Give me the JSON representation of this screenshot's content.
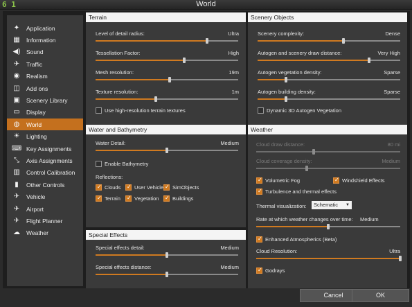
{
  "window": {
    "title": "World",
    "logo": "6 1"
  },
  "sidebar": {
    "items": [
      {
        "label": "Application",
        "icon": "rocket"
      },
      {
        "label": "Information",
        "icon": "▦"
      },
      {
        "label": "Sound",
        "icon": "◀)"
      },
      {
        "label": "Traffic",
        "icon": "✈"
      },
      {
        "label": "Realism",
        "icon": "◉"
      },
      {
        "label": "Add ons",
        "icon": "◫"
      },
      {
        "label": "Scenery Library",
        "icon": "▣"
      },
      {
        "label": "Display",
        "icon": "▭"
      },
      {
        "label": "World",
        "icon": "◍",
        "active": true
      },
      {
        "label": "Lighting",
        "icon": "☀"
      },
      {
        "label": "Key Assignments",
        "icon": "⌨"
      },
      {
        "label": "Axis Assignments",
        "icon": "⤡"
      },
      {
        "label": "Control Calibration",
        "icon": "▥"
      },
      {
        "label": "Other Controls",
        "icon": "▮"
      },
      {
        "label": "Vehicle",
        "icon": "✈"
      },
      {
        "label": "Airport",
        "icon": "✈"
      },
      {
        "label": "Flight Planner",
        "icon": "✈"
      },
      {
        "label": "Weather",
        "icon": "☁"
      }
    ]
  },
  "terrain": {
    "header": "Terrain",
    "rows": [
      {
        "label": "Level of detail radius:",
        "value": "Ultra",
        "level": 0.78
      },
      {
        "label": "Tessellation Factor:",
        "value": "High",
        "level": 0.62
      },
      {
        "label": "Mesh resolution:",
        "value": "19m",
        "level": 0.52
      },
      {
        "label": "Texture resolution:",
        "value": "1m",
        "level": 0.42
      }
    ],
    "checkbox": {
      "label": "Use high-resolution terrain textures",
      "checked": false
    }
  },
  "scenery": {
    "header": "Scenery Objects",
    "rows": [
      {
        "label": "Scenery complexity:",
        "value": "Dense",
        "level": 0.6
      },
      {
        "label": "Autogen and scenery draw distance:",
        "value": "Very High",
        "level": 0.78
      },
      {
        "label": "Autogen vegetation density:",
        "value": "Sparse",
        "level": 0.2
      },
      {
        "label": "Autogen building density:",
        "value": "Sparse",
        "level": 0.2
      }
    ],
    "checkbox": {
      "label": "Dynamic 3D Autogen Vegetation",
      "checked": false
    }
  },
  "water": {
    "header": "Water and Bathymetry",
    "detail": {
      "label": "Water Detail:",
      "value": "Medium",
      "level": 0.5
    },
    "bathymetry": {
      "label": "Enable Bathymetry",
      "checked": false
    },
    "reflections_label": "Reflections:",
    "reflections": [
      {
        "label": "Clouds",
        "checked": true
      },
      {
        "label": "User Vehicle",
        "checked": true
      },
      {
        "label": "SimObjects",
        "checked": true
      },
      {
        "label": "Terrain",
        "checked": true
      },
      {
        "label": "Vegetation",
        "checked": true
      },
      {
        "label": "Buildings",
        "checked": true
      }
    ]
  },
  "effects": {
    "header": "Special Effects",
    "rows": [
      {
        "label": "Special effects detail:",
        "value": "Medium",
        "level": 0.5
      },
      {
        "label": "Special effects distance:",
        "value": "Medium",
        "level": 0.5
      }
    ]
  },
  "weather": {
    "header": "Weather",
    "cloud_draw": {
      "label": "Cloud draw distance:",
      "value": "80 mi",
      "level": 0.4
    },
    "cloud_coverage": {
      "label": "Cloud coverage density:",
      "value": "Medium",
      "level": 0.35
    },
    "volumetric_fog": {
      "label": "Volumetric Fog",
      "checked": true
    },
    "windshield": {
      "label": "Windshield Effects",
      "checked": true
    },
    "turbulence": {
      "label": "Turbulence and thermal effects",
      "checked": true
    },
    "thermal_label": "Thermal visualization:",
    "thermal_value": "Schematic",
    "rate_label": "Rate at which weather changes over time:",
    "rate_value": "Medium",
    "rate_level": 0.5,
    "enhanced": {
      "label": "Enhanced Atmospherics (Beta)",
      "checked": true
    },
    "cloud_res": {
      "label": "Cloud Resolution:",
      "value": "Ultra",
      "level": 1.0
    },
    "godrays": {
      "label": "Godrays",
      "checked": true
    }
  },
  "footer": {
    "cancel": "Cancel",
    "ok": "OK"
  },
  "colors": {
    "accent": "#d07a20",
    "active_nav": "#c4701e",
    "header_bg": "#f4f4f4"
  }
}
